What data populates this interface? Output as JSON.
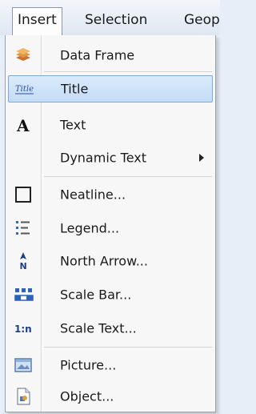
{
  "menubar": {
    "items": [
      {
        "label": "Insert"
      },
      {
        "label": "Selection"
      },
      {
        "label": "Geop"
      }
    ]
  },
  "menu": {
    "items": [
      {
        "label": "Data Frame",
        "icon": "data-frame-icon"
      },
      {
        "label": "Title",
        "icon": "title-icon"
      },
      {
        "label": "Text",
        "icon": "text-icon"
      },
      {
        "label": "Dynamic Text",
        "icon": "",
        "submenu": true
      },
      {
        "label": "Neatline...",
        "icon": "neatline-icon"
      },
      {
        "label": "Legend...",
        "icon": "legend-icon"
      },
      {
        "label": "North Arrow...",
        "icon": "north-arrow-icon"
      },
      {
        "label": "Scale Bar...",
        "icon": "scale-bar-icon"
      },
      {
        "label": "Scale Text...",
        "icon": "scale-text-icon"
      },
      {
        "label": "Picture...",
        "icon": "picture-icon"
      },
      {
        "label": "Object...",
        "icon": "object-icon"
      }
    ],
    "title_icon_text": "Title",
    "text_icon_glyph": "A",
    "scale_text_icon_text": "1:n",
    "north_icon_letter": "N"
  }
}
